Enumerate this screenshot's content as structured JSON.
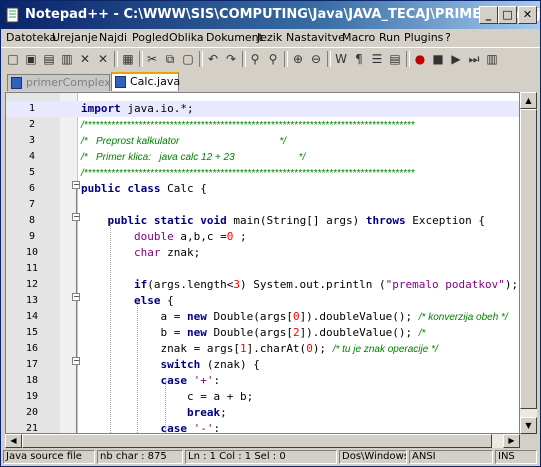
{
  "window": {
    "title": "Notepad++ - C:\\WWW\\SIS\\COMPUTING\\Java\\JAVA_TECAJ\\PRIMERI\\Calc.java",
    "minimize": "_",
    "maximize": "□",
    "close": "✕"
  },
  "menu": [
    "Datoteka",
    "Urejanje",
    "Najdi",
    "Pogled",
    "Oblika",
    "Dokument",
    "Jezik",
    "Nastavitve",
    "Macro",
    "Run",
    "Plugins",
    "?"
  ],
  "toolbar": {
    "icons": [
      "new-file-icon",
      "open-icon",
      "save-icon",
      "save-all-icon",
      "close-icon",
      "close-all-icon",
      "print-icon",
      "cut-icon",
      "copy-icon",
      "paste-icon",
      "undo-icon",
      "redo-icon",
      "find-icon",
      "replace-icon",
      "zoom-in-icon",
      "zoom-out-icon",
      "wrap-icon",
      "show-all-chars-icon",
      "indent-guide-icon",
      "user-lang-icon",
      "record-macro-icon",
      "stop-macro-icon",
      "play-macro-icon",
      "run-macro-icon",
      "save-macro-icon"
    ],
    "glyphs": [
      "□",
      "▣",
      "▤",
      "▥",
      "✕",
      "✕",
      "▦",
      "✂",
      "⧉",
      "▢",
      "↶",
      "↷",
      "⚲",
      "⚲",
      "⊕",
      "⊖",
      "W",
      "¶",
      "☰",
      "▤",
      "●",
      "■",
      "▶",
      "⏭",
      "▥"
    ]
  },
  "tabs": [
    {
      "label": "primerComplex.java",
      "active": false
    },
    {
      "label": "Calc.java",
      "active": true
    }
  ],
  "editor": {
    "lines": [
      {
        "n": "1",
        "html": "<span class=\"kw\">import</span> java.io.*;"
      },
      {
        "n": "2",
        "html": "<span class=\"cmt\">/*************************************************************************************</span>"
      },
      {
        "n": "3",
        "html": "<span class=\"cmt\">/*   Preprost kalkulator                                    */</span>"
      },
      {
        "n": "4",
        "html": "<span class=\"cmt\">/*   Primer klica:   java calc 12 + 23                       */</span>"
      },
      {
        "n": "5",
        "html": "<span class=\"cmt\">/*************************************************************************************</span>"
      },
      {
        "n": "6",
        "html": "<span class=\"kw\">public</span> <span class=\"kw\">class</span> Calc {"
      },
      {
        "n": "7",
        "html": ""
      },
      {
        "n": "8",
        "html": "    <span class=\"kw\">public</span> <span class=\"kw\">static</span> <span class=\"kw\">void</span> main(String[] args) <span class=\"kw\">throws</span> Exception {"
      },
      {
        "n": "9",
        "html": "        <span class=\"ty\">double</span> a,b,c =<span class=\"num\">0</span> ;"
      },
      {
        "n": "10",
        "html": "        <span class=\"ty\">char</span> znak;"
      },
      {
        "n": "11",
        "html": ""
      },
      {
        "n": "12",
        "html": "        <span class=\"kw\">if</span>(args.length&lt;<span class=\"num\">3</span>) System.out.println (<span class=\"str\">\"premalo podatkov\"</span>);"
      },
      {
        "n": "13",
        "html": "        <span class=\"kw\">else</span> {"
      },
      {
        "n": "14",
        "html": "            a = <span class=\"kw\">new</span> Double(args[<span class=\"num\">0</span>]).doubleValue(); <span class=\"cmt\">/* konverzija obeh */</span>"
      },
      {
        "n": "15",
        "html": "            b = <span class=\"kw\">new</span> Double(args[<span class=\"num\">2</span>]).doubleValue(); <span class=\"cmt\">/*</span>"
      },
      {
        "n": "16",
        "html": "            znak = args[<span class=\"num\">1</span>].charAt(<span class=\"num\">0</span>); <span class=\"cmt\">/* tu je znak operacije */</span>"
      },
      {
        "n": "17",
        "html": "            <span class=\"kw\">switch</span> (znak) {"
      },
      {
        "n": "18",
        "html": "            <span class=\"kw\">case</span> <span class=\"str\">'+'</span>:"
      },
      {
        "n": "19",
        "html": "                c = a + b;"
      },
      {
        "n": "20",
        "html": "                <span class=\"kw\">break</span>;"
      },
      {
        "n": "21",
        "html": "            <span class=\"kw\">case</span> <span class=\"str\">'-'</span>:"
      }
    ]
  },
  "status": {
    "type": "Java source file",
    "chars": "nb char : 875",
    "pos": "Ln : 1    Col : 1    Sel : 0",
    "eol": "Dos\\Windows",
    "enc": "ANSI",
    "mode": "INS"
  },
  "colors": {
    "title_start": "#0a246a",
    "title_end": "#a6caf0",
    "keyword": "#00007f",
    "comment": "#007f00"
  }
}
